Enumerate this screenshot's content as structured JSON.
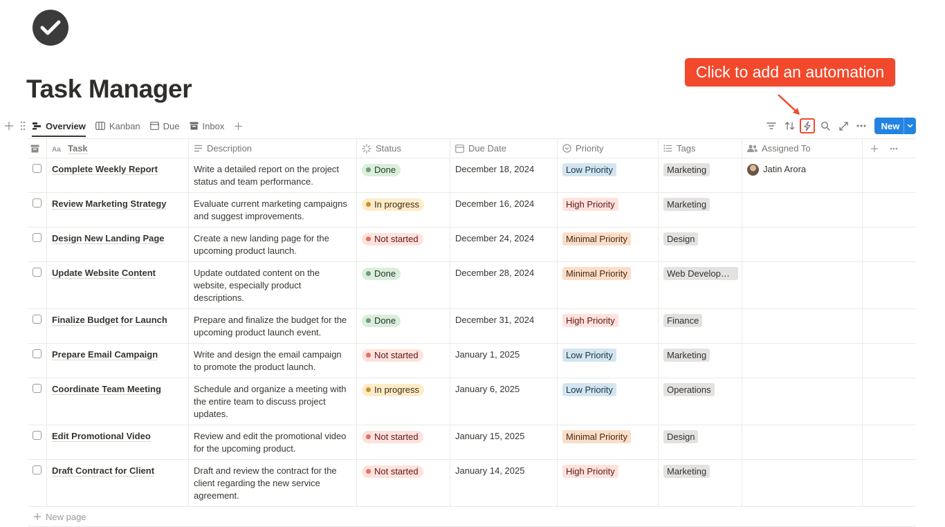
{
  "page": {
    "icon": "check-circle-icon",
    "title": "Task Manager"
  },
  "callout": {
    "text": "Click to add an automation",
    "color": "#f2482b"
  },
  "views": [
    {
      "label": "Overview",
      "icon": "table-icon",
      "active": true
    },
    {
      "label": "Kanban",
      "icon": "board-icon"
    },
    {
      "label": "Due",
      "icon": "calendar-icon"
    },
    {
      "label": "Inbox",
      "icon": "inbox-icon"
    }
  ],
  "toolbar": {
    "tools": [
      "filter-icon",
      "sort-icon",
      "lightning-icon",
      "search-icon",
      "expand-icon",
      "more-icon"
    ],
    "new_label": "New",
    "accent": "#2383e2"
  },
  "columns": {
    "task": "Task",
    "description": "Description",
    "status": "Status",
    "due": "Due Date",
    "priority": "Priority",
    "tags": "Tags",
    "assigned": "Assigned To"
  },
  "rows": [
    {
      "task": "Complete Weekly Report",
      "description": "Write a detailed report on the project status and team performance.",
      "status": "Done",
      "due": "December 18, 2024",
      "priority": "Low Priority",
      "tag": "Marketing",
      "assigned": "Jatin Arora"
    },
    {
      "task": "Review Marketing Strategy",
      "description": "Evaluate current marketing campaigns and suggest improvements.",
      "status": "In progress",
      "due": "December 16, 2024",
      "priority": "High Priority",
      "tag": "Marketing",
      "assigned": ""
    },
    {
      "task": "Design New Landing Page",
      "description": "Create a new landing page for the upcoming product launch.",
      "status": "Not started",
      "due": "December 24, 2024",
      "priority": "Minimal Priority",
      "tag": "Design",
      "assigned": ""
    },
    {
      "task": "Update Website Content",
      "description": "Update outdated content on the website, especially product descriptions.",
      "status": "Done",
      "due": "December 28, 2024",
      "priority": "Minimal Priority",
      "tag": "Web Developm...",
      "assigned": ""
    },
    {
      "task": "Finalize Budget for Launch",
      "description": "Prepare and finalize the budget for the upcoming product launch event.",
      "status": "Done",
      "due": "December 31, 2024",
      "priority": "High Priority",
      "tag": "Finance",
      "assigned": ""
    },
    {
      "task": "Prepare Email Campaign",
      "description": "Write and design the email campaign to promote the product launch.",
      "status": "Not started",
      "due": "January 1, 2025",
      "priority": "Low Priority",
      "tag": "Marketing",
      "assigned": ""
    },
    {
      "task": "Coordinate Team Meeting",
      "description": "Schedule and organize a meeting with the entire team to discuss project updates.",
      "status": "In progress",
      "due": "January 6, 2025",
      "priority": "Low Priority",
      "tag": "Operations",
      "assigned": ""
    },
    {
      "task": "Edit Promotional Video",
      "description": "Review and edit the promotional video for the upcoming product.",
      "status": "Not started",
      "due": "January 15, 2025",
      "priority": "Minimal Priority",
      "tag": "Design",
      "assigned": ""
    },
    {
      "task": "Draft Contract for Client",
      "description": "Draft and review the contract for the client regarding the new service agreement.",
      "status": "Not started",
      "due": "January 14, 2025",
      "priority": "High Priority",
      "tag": "Marketing",
      "assigned": ""
    }
  ],
  "new_page_label": "New page"
}
